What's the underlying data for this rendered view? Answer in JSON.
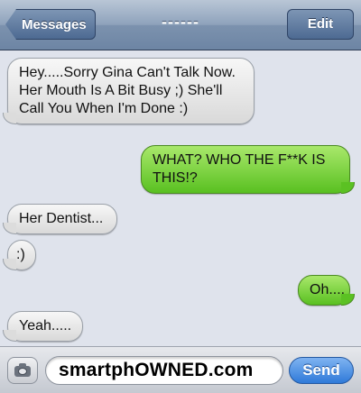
{
  "navbar": {
    "back_label": "Messages",
    "title": "------",
    "edit_label": "Edit"
  },
  "messages": [
    {
      "side": "received",
      "text": "Hey.....Sorry Gina Can't Talk Now. Her Mouth Is A Bit Busy ;) She'll Call You When I'm Done :)"
    },
    {
      "side": "sent",
      "text": "WHAT? WHO THE F**K IS THIS!?"
    },
    {
      "side": "received",
      "text": "Her Dentist..."
    },
    {
      "side": "received",
      "text": ":)"
    },
    {
      "side": "sent",
      "text": "Oh...."
    },
    {
      "side": "received",
      "text": "Yeah....."
    }
  ],
  "composer": {
    "text_value": "smartphOWNED.com",
    "send_label": "Send",
    "camera_icon": "camera-icon"
  },
  "colors": {
    "received_bubble": "#e6e6e6",
    "sent_bubble": "#78d23a",
    "background": "#dfe3ec",
    "navbar": "#7c92ae",
    "send_button": "#2f7ad9"
  }
}
